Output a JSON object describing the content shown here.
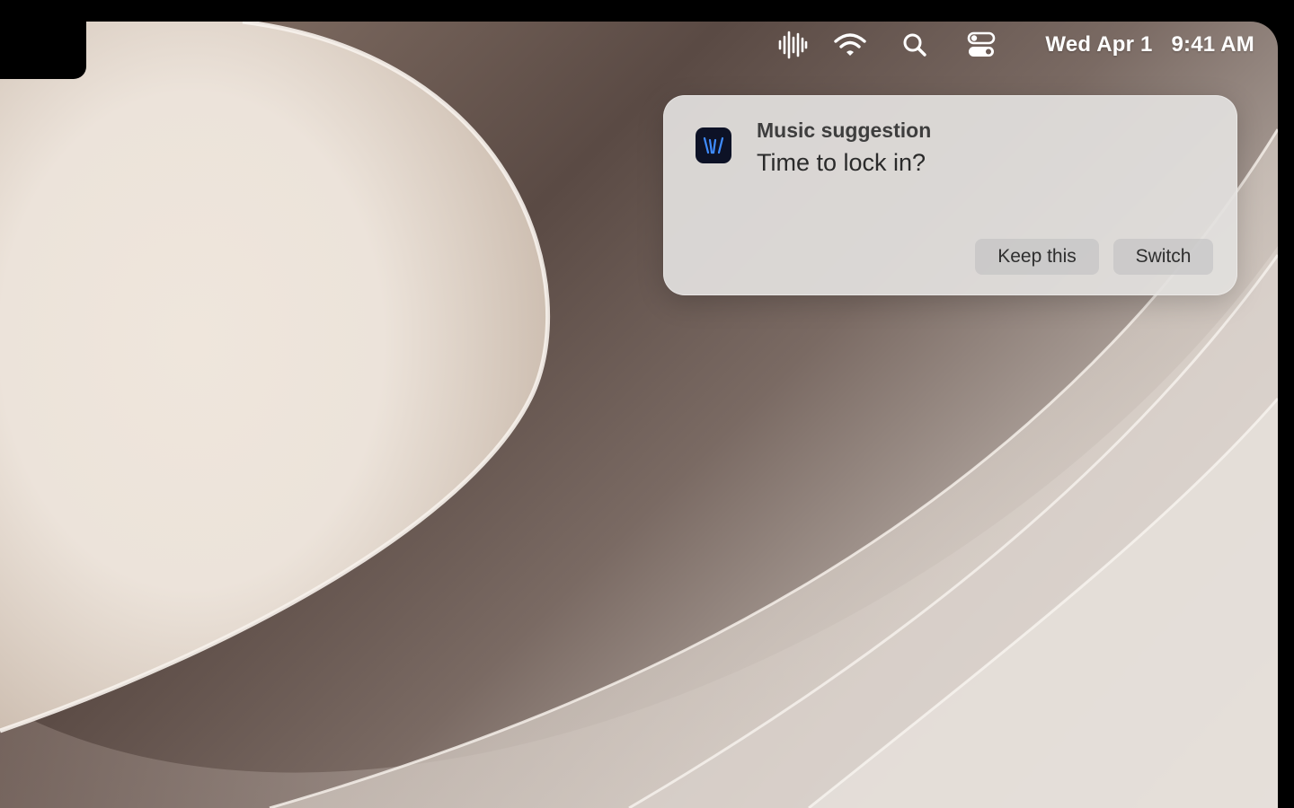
{
  "menubar": {
    "icons": [
      "audio-waveform-icon",
      "wifi-icon",
      "search-icon",
      "control-center-icon"
    ],
    "date": "Wed Apr 1",
    "time": "9:41 AM"
  },
  "notification": {
    "app_icon": "music-app-icon",
    "title": "Music suggestion",
    "body": "Time to lock in?",
    "actions": {
      "keep": "Keep this",
      "switch": "Switch"
    }
  },
  "colors": {
    "icon_background": "#0d1226",
    "icon_accent": "#3f8cff",
    "notification_bg": "#e2e0de"
  }
}
